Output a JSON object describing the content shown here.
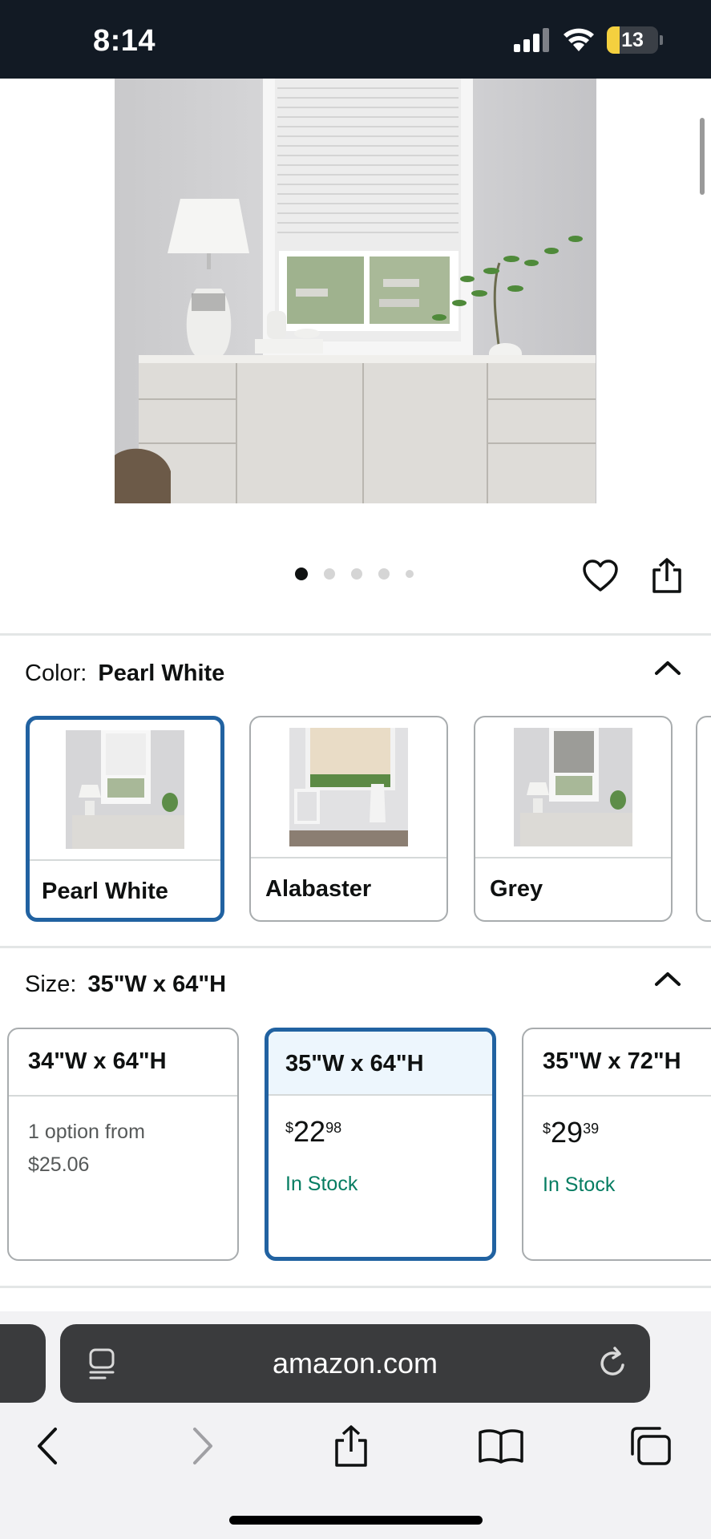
{
  "status_bar": {
    "time": "8:14",
    "battery_level": "13",
    "icons": [
      "cellular-signal-icon",
      "wifi-icon",
      "battery-icon"
    ]
  },
  "product": {
    "image_description_icon": "product-photo",
    "carousel": {
      "total": 5,
      "active_index": 0
    },
    "actions": [
      "heart-icon",
      "share-icon"
    ]
  },
  "color": {
    "label": "Color:",
    "selected": "Pearl White",
    "options": [
      {
        "name": "Pearl White",
        "selected": true,
        "shade": "#f4f4f2"
      },
      {
        "name": "Alabaster",
        "selected": false,
        "shade": "#e9dcc6"
      },
      {
        "name": "Grey",
        "selected": false,
        "shade": "#9c9c98"
      }
    ]
  },
  "size": {
    "label": "Size:",
    "selected": "35\"W x 64\"H",
    "options": [
      {
        "name": "34\"W x 64\"H",
        "line1": "1 option from",
        "line2": "$25.06",
        "selected": false
      },
      {
        "name": "35\"W x 64\"H",
        "price_symbol": "$",
        "price_whole": "22",
        "price_fraction": "98",
        "stock": "In Stock",
        "selected": true
      },
      {
        "name": "35\"W x 72\"H",
        "price_symbol": "$",
        "price_whole": "29",
        "price_fraction": "39",
        "stock": "In Stock",
        "selected": false
      }
    ]
  },
  "browser": {
    "url": "amazon.com",
    "icons": [
      "reader-icon",
      "reload-icon"
    ],
    "toolbar": [
      "back-icon",
      "forward-icon",
      "share-icon",
      "bookmarks-icon",
      "tabs-icon"
    ]
  },
  "colors": {
    "accent_blue": "#2162a1",
    "in_stock_green": "#067d62",
    "status_bar_bg": "#121a24"
  }
}
